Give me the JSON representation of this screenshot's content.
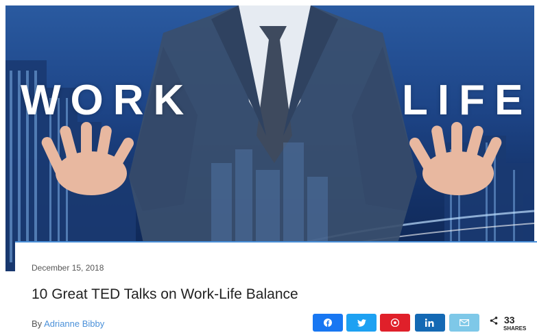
{
  "hero": {
    "word_left": "WORK",
    "word_right": "LIFE"
  },
  "post": {
    "date": "December 15, 2018",
    "title": "10 Great TED Talks on Work-Life Balance",
    "by_prefix": "By",
    "author": "Adrianne Bibby"
  },
  "share": {
    "buttons": [
      {
        "network": "facebook",
        "icon": "facebook-icon",
        "color": "#1877f2"
      },
      {
        "network": "twitter",
        "icon": "twitter-icon",
        "color": "#1da1f2"
      },
      {
        "network": "pinterest",
        "icon": "pinterest-icon",
        "color": "#e0202a"
      },
      {
        "network": "linkedin",
        "icon": "linkedin-icon",
        "color": "#1469b4"
      },
      {
        "network": "email",
        "icon": "email-icon",
        "color": "#7ec8e8"
      }
    ],
    "count": "33",
    "count_label": "SHARES"
  },
  "colors": {
    "accent": "#4a90d9",
    "hero_blue": "#1d4486"
  }
}
